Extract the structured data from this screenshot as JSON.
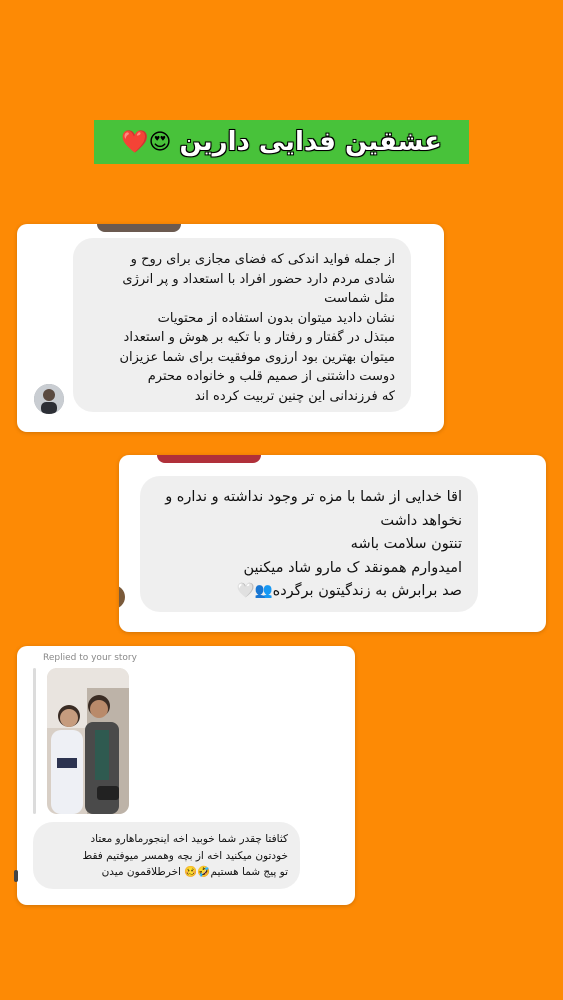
{
  "banner": {
    "title": "عشقین فدایی دارین",
    "emojis": "😍❤️"
  },
  "message1": {
    "lines": [
      "از جمله فواید اندکی که فضای مجازی برای روح و",
      "شادی مردم دارد حضور افراد با استعداد و پر انرژی",
      "مثل شماست",
      "نشان دادید میتوان بدون استفاده از محتویات",
      "مبتذل در گفتار و رفتار و با تکیه بر هوش و استعداد",
      "میتوان بهترین بود ارزوی موفقیت برای شما عزیزان",
      "دوست داشتنی از صمیم قلب و خانواده محترم",
      "که فرزندانی این چنین تربیت کرده اند"
    ]
  },
  "message2": {
    "lines": [
      "اقا خدایی از شما با مزه تر وجود نداشته و نداره و",
      "نخواهد داشت",
      "تنتون سلامت باشه",
      "امیدوارم همونقد ک مارو شاد میکنین",
      "صد برابرش به زندگیتون برگرده👥🤍"
    ]
  },
  "message3": {
    "replied_label": "Replied to your story",
    "lines": [
      "کثافتا چقدر شما خوبید اخه اینجورماهارو معتاد",
      "خودتون میکنید اخه از بچه وهمسر میوفتیم فقط",
      "تو پیج شما هستیم🤣🥴 اخرطلاقمون میدن"
    ]
  },
  "colors": {
    "background": "#fd8a05",
    "banner": "#48c23a",
    "bubble": "#efefef"
  }
}
